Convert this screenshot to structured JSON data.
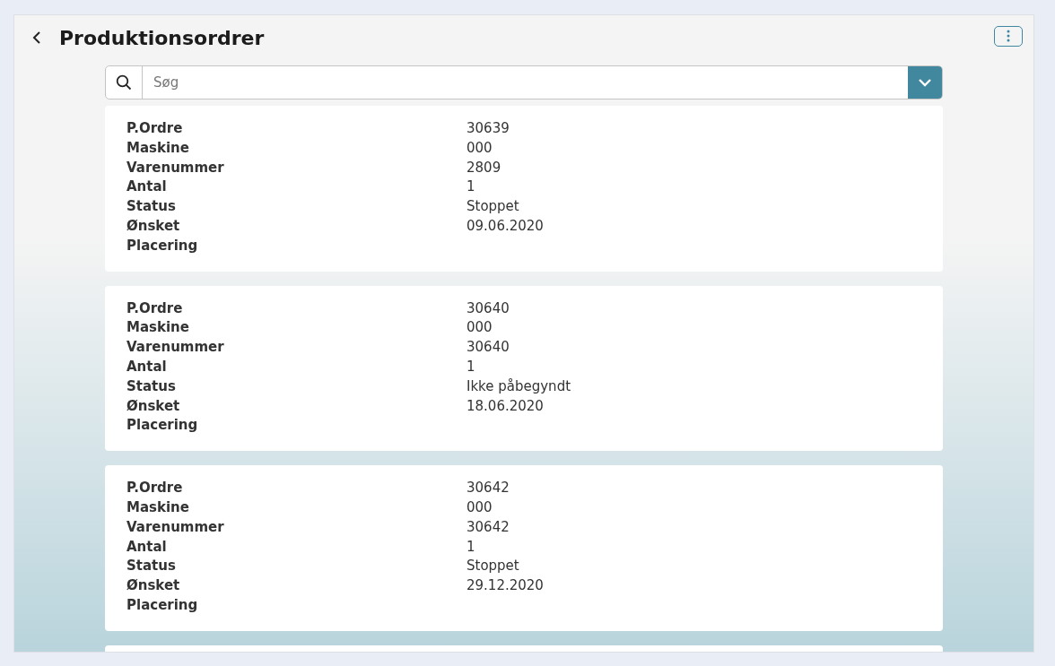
{
  "header": {
    "title": "Produktionsordrer"
  },
  "search": {
    "placeholder": "Søg"
  },
  "orders": [
    {
      "fields": [
        {
          "label": "P.Ordre",
          "value": "30639"
        },
        {
          "label": "Maskine",
          "value": "000"
        },
        {
          "label": "Varenummer",
          "value": "2809"
        },
        {
          "label": "Antal",
          "value": "1"
        },
        {
          "label": "Status",
          "value": "Stoppet"
        },
        {
          "label": "Ønsket",
          "value": "09.06.2020"
        },
        {
          "label": "Placering"
        }
      ]
    },
    {
      "fields": [
        {
          "label": "P.Ordre",
          "value": "30640"
        },
        {
          "label": "Maskine",
          "value": "000"
        },
        {
          "label": "Varenummer",
          "value": "30640"
        },
        {
          "label": "Antal",
          "value": "1"
        },
        {
          "label": "Status",
          "value": "Ikke påbegyndt"
        },
        {
          "label": "Ønsket",
          "value": "18.06.2020"
        },
        {
          "label": "Placering"
        }
      ]
    },
    {
      "fields": [
        {
          "label": "P.Ordre",
          "value": "30642"
        },
        {
          "label": "Maskine",
          "value": "000"
        },
        {
          "label": "Varenummer",
          "value": "30642"
        },
        {
          "label": "Antal",
          "value": "1"
        },
        {
          "label": "Status",
          "value": "Stoppet"
        },
        {
          "label": "Ønsket",
          "value": "29.12.2020"
        },
        {
          "label": "Placering"
        }
      ]
    },
    {
      "kind": "empty"
    }
  ]
}
